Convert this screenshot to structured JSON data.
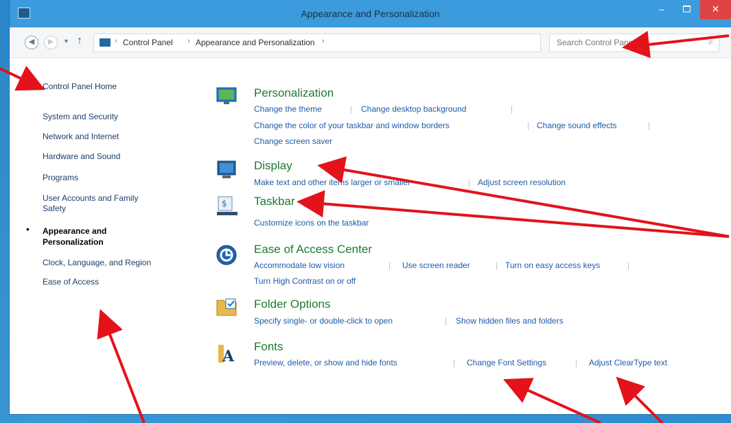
{
  "window": {
    "title": "Appearance and Personalization",
    "controls": {
      "minimize": "–",
      "close": "✕"
    }
  },
  "address": {
    "crumbs": [
      "Control Panel",
      "Appearance and Personalization"
    ],
    "separator": "›",
    "search_placeholder": "Search Control Panel",
    "icons": {
      "back": "back-arrow-icon",
      "forward": "forward-arrow-icon",
      "up": "up-arrow-icon",
      "refresh": "refresh-icon",
      "search": "search-icon"
    }
  },
  "sidebar": {
    "home": "Control Panel Home",
    "items": [
      "System and Security",
      "Network and Internet",
      "Hardware and Sound",
      "Programs",
      "User Accounts and Family",
      "Safety"
    ],
    "current_line1": "Appearance and",
    "current_line2": "Personalization",
    "after_items": [
      "Clock, Language, and Region",
      "Ease of Access"
    ]
  },
  "categories": [
    {
      "title": "Personalization",
      "links": [
        "Change the theme",
        "Change desktop background",
        "Change the color of your taskbar and window borders",
        "Change sound effects",
        "Change screen saver"
      ]
    },
    {
      "title": "Display",
      "links": [
        "Make text and other items larger or smaller",
        "Adjust screen resolution"
      ]
    },
    {
      "title": "Taskbar",
      "links": [
        "Customize icons on the taskbar"
      ]
    },
    {
      "title": "Ease of Access Center",
      "links": [
        "Accommodate low vision",
        "Use screen reader",
        "Turn on easy access keys",
        "Turn High Contrast on or off"
      ]
    },
    {
      "title": "Folder Options",
      "links": [
        "Specify single- or double-click to open",
        "Show hidden files and folders"
      ]
    },
    {
      "title": "Fonts",
      "links": [
        "Preview, delete, or show and hide fonts",
        "Change Font Settings",
        "Adjust ClearType text"
      ]
    }
  ],
  "colors": {
    "titlebar": "#3b9bdc",
    "category_title": "#1e7a2e",
    "link": "#1e5aa8",
    "annotation_arrow": "#e3121b"
  }
}
